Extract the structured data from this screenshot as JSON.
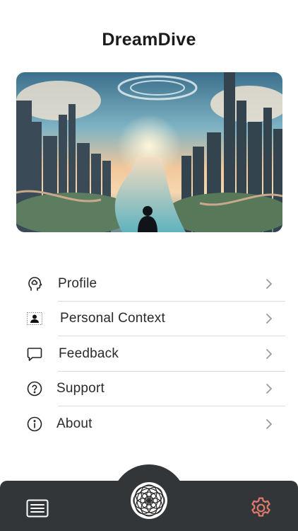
{
  "app": {
    "title": "DreamDive"
  },
  "hero": {
    "alt": "Dreamlike city landscape with river and figure"
  },
  "menu": {
    "items": [
      {
        "label": "Profile",
        "icon": "brain-head-icon"
      },
      {
        "label": "Personal Context",
        "icon": "person-card-icon"
      },
      {
        "label": "Feedback",
        "icon": "chat-bubble-icon"
      },
      {
        "label": "Support",
        "icon": "question-circle-icon"
      },
      {
        "label": "About",
        "icon": "info-circle-icon"
      }
    ]
  },
  "tabbar": {
    "items": [
      {
        "name": "journal",
        "icon": "list-icon",
        "active": false
      },
      {
        "name": "dream",
        "icon": "dreamcatcher-icon",
        "active": false
      },
      {
        "name": "settings",
        "icon": "gear-icon",
        "active": true
      }
    ],
    "active_color": "#e07a6b",
    "inactive_color": "#ffffff",
    "bar_color": "#333638"
  }
}
